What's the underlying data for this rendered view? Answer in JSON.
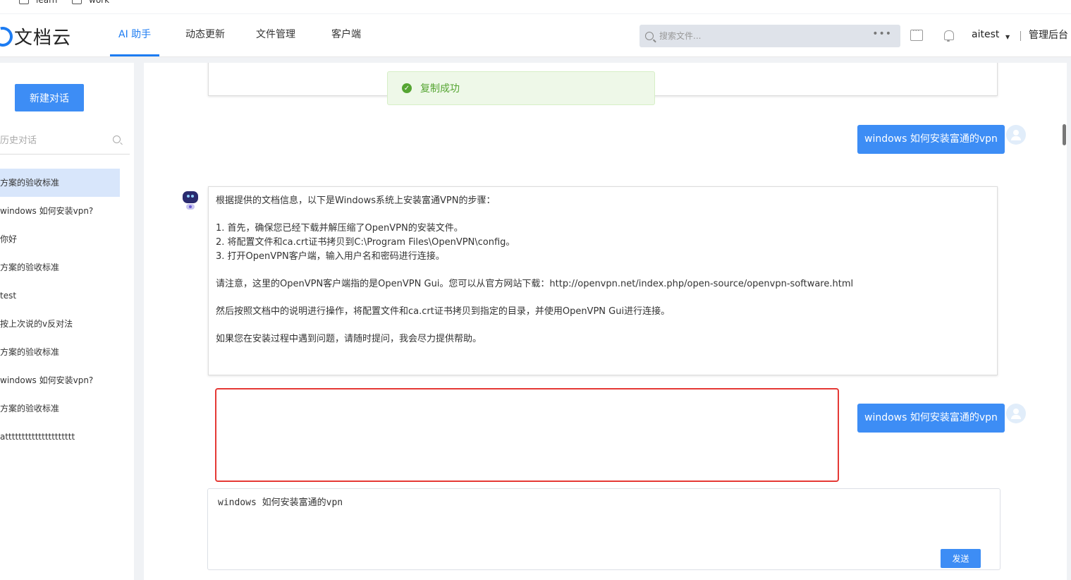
{
  "bookmarks": [
    {
      "label": "learn",
      "icon": "folder-icon"
    },
    {
      "label": "work",
      "icon": "folder-icon"
    }
  ],
  "app": {
    "name": "文档云"
  },
  "nav": {
    "items": [
      "AI 助手",
      "动态更新",
      "文件管理",
      "客户端"
    ],
    "active_index": 0
  },
  "search": {
    "placeholder": "搜索文件..."
  },
  "user": {
    "name": "aitest",
    "admin_link": "管理后台"
  },
  "sidebar": {
    "new_chat_label": "新建对话",
    "search_placeholder": "历史对话",
    "history": [
      "方案的验收标准",
      "windows 如何安装vpn?",
      "你好",
      "方案的验收标准",
      "test",
      "按上次说的v反对法",
      "方案的验收标准",
      "windows 如何安装vpn?",
      "方案的验收标准",
      "attttttttttttttttttttt"
    ],
    "active_index": 0
  },
  "toast": {
    "message": "复制成功"
  },
  "chat": {
    "user_message_1": "windows 如何安装富通的vpn",
    "answer_lines": [
      "根据提供的文档信息，以下是Windows系统上安装富通VPN的步骤：",
      "",
      "1. 首先，确保您已经下载并解压缩了OpenVPN的安装文件。",
      "2. 将配置文件和ca.crt证书拷贝到C:\\Program Files\\OpenVPN\\config。",
      "3. 打开OpenVPN客户端，输入用户名和密码进行连接。",
      "",
      "请注意，这里的OpenVPN客户端指的是OpenVPN Gui。您可以从官方网站下载：http://openvpn.net/index.php/open-source/openvpn-software.html",
      "",
      "然后按照文档中的说明进行操作，将配置文件和ca.crt证书拷贝到指定的目录，并使用OpenVPN Gui进行连接。",
      "",
      "如果您在安装过程中遇到问题，请随时提问，我会尽力提供帮助。"
    ],
    "user_message_2": "windows 如何安装富通的vpn"
  },
  "composer": {
    "value": "windows 如何安装富通的vpn",
    "send_label": "发送"
  },
  "colors": {
    "primary": "#3d8df5",
    "active_bg": "#d8e6fb",
    "highlight_border": "#e53935",
    "success": "#55a532"
  }
}
